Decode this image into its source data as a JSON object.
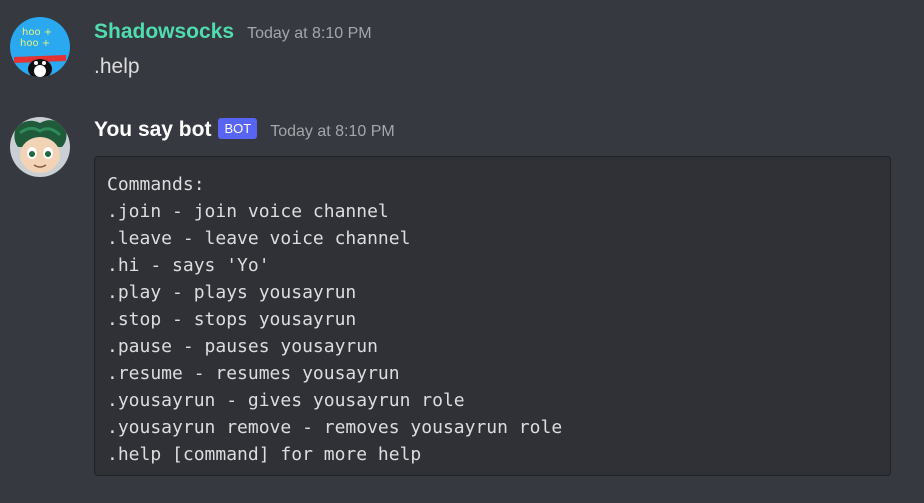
{
  "messages": [
    {
      "author": "Shadowsocks",
      "author_color": "#4fdcae",
      "timestamp": "Today at 8:10 PM",
      "content": ".help"
    },
    {
      "author": "You say bot",
      "author_color": "#ffffff",
      "bot_tag": "BOT",
      "timestamp": "Today at 8:10 PM",
      "code_lines": [
        "Commands:",
        ".join - join voice channel",
        ".leave - leave voice channel",
        ".hi - says 'Yo'",
        ".play - plays yousayrun",
        ".stop - stops yousayrun",
        ".pause - pauses yousayrun",
        ".resume - resumes yousayrun",
        ".yousayrun - gives yousayrun role",
        ".yousayrun remove - removes yousayrun role",
        ".help [command] for more help"
      ]
    }
  ]
}
